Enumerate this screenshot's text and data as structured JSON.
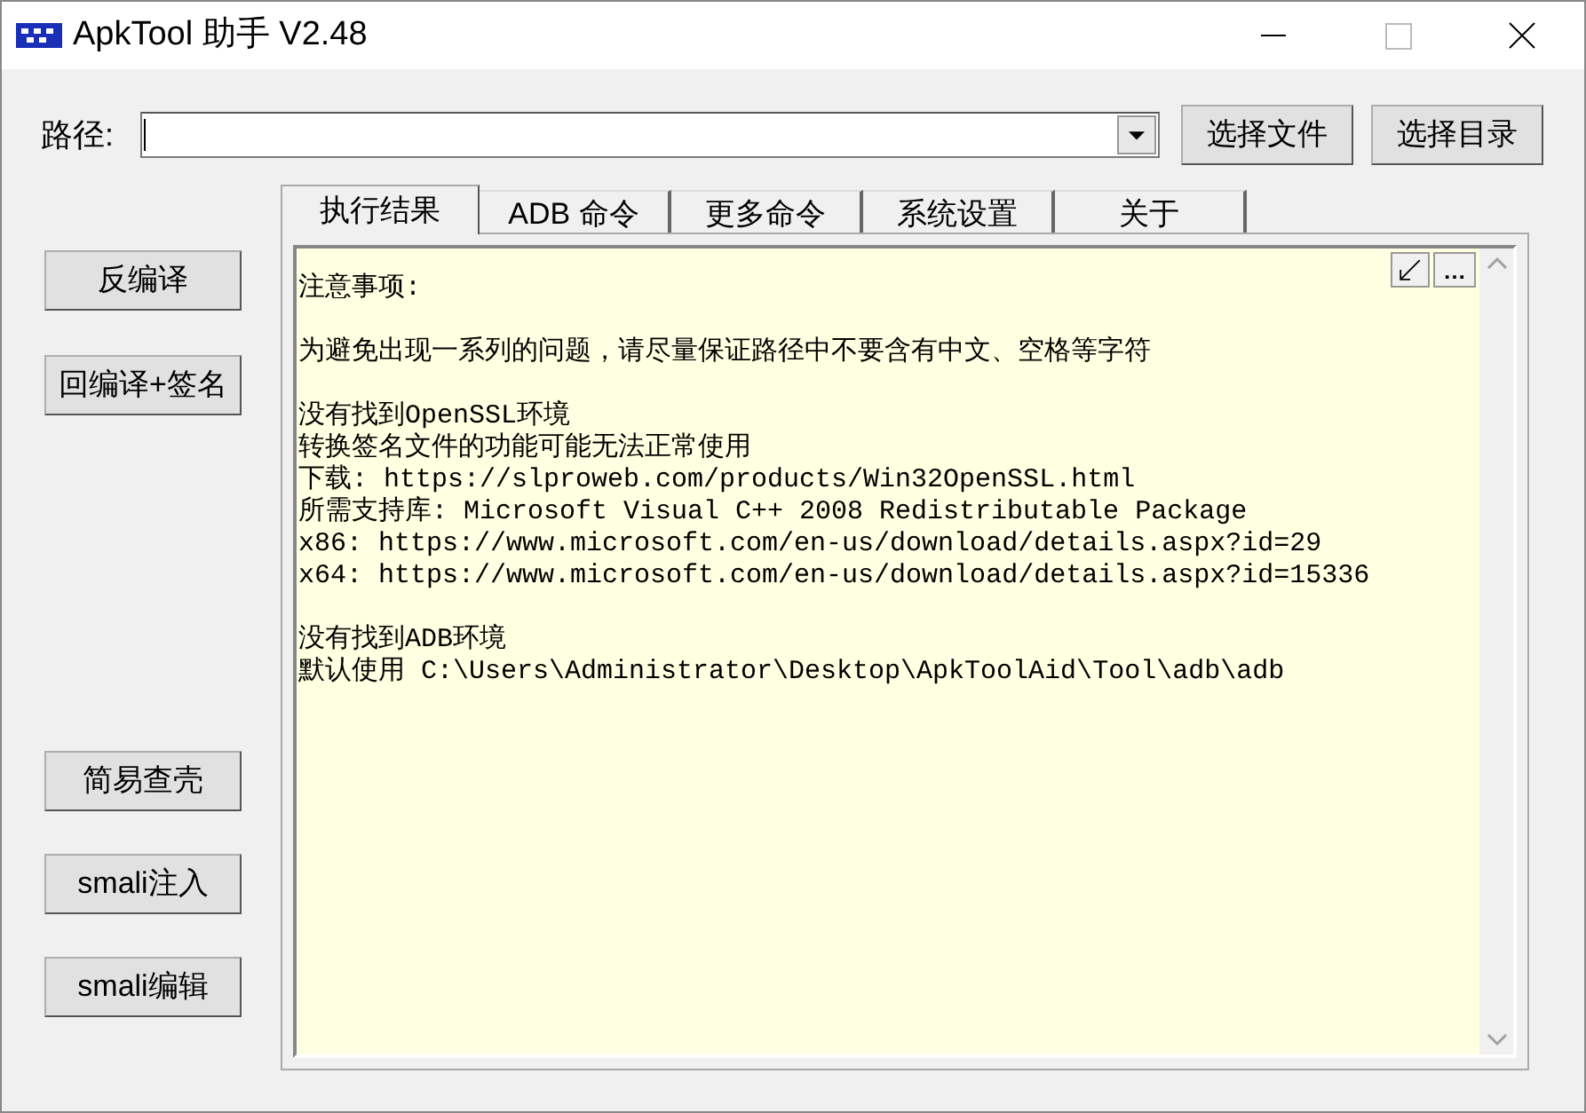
{
  "window": {
    "title": "ApkTool 助手 V2.48"
  },
  "path": {
    "label": "路径:"
  },
  "path_buttons": [
    "选择文件",
    "选择目录"
  ],
  "tabs": [
    {
      "label": "执行结果",
      "selected": true
    },
    {
      "label": "ADB 命令",
      "selected": false
    },
    {
      "label": "更多命令",
      "selected": false
    },
    {
      "label": "系统设置",
      "selected": false
    },
    {
      "label": "关于",
      "selected": false
    }
  ],
  "side_buttons_top": [
    "反编译",
    "回编译+签名"
  ],
  "side_buttons_bottom": [
    "简易查壳",
    "smali注入",
    "smali编辑"
  ],
  "output_tools": [
    "…"
  ],
  "output": [
    [
      "注意事项:"
    ],
    [
      "为避免出现一系列的问题，请尽量保证路径中不要含有中文、空格等字符"
    ],
    [
      "没有找到OpenSSL环境",
      "转换签名文件的功能可能无法正常使用",
      "下载: https://slproweb.com/products/Win32OpenSSL.html",
      "所需支持库: Microsoft Visual C++ 2008 Redistributable Package",
      "x86: https://www.microsoft.com/en-us/download/details.aspx?id=29",
      "x64: https://www.microsoft.com/en-us/download/details.aspx?id=15336"
    ],
    [
      "没有找到ADB环境",
      "默认使用 C:\\Users\\Administrator\\Desktop\\ApkToolAid\\Tool\\adb\\adb"
    ]
  ]
}
